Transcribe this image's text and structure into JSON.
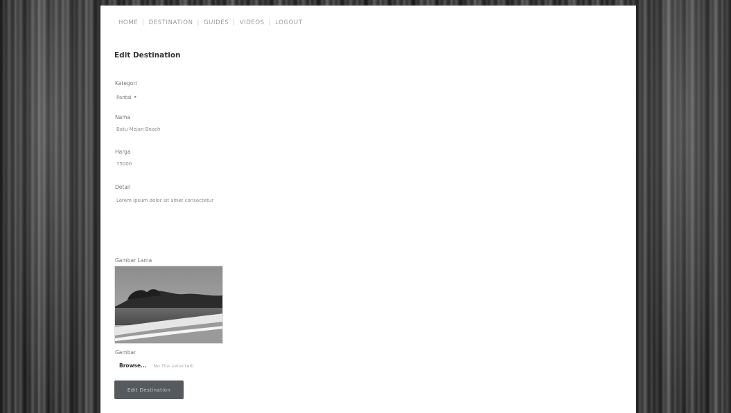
{
  "nav": {
    "items": [
      {
        "label": "HOME"
      },
      {
        "label": "DESTINATION"
      },
      {
        "label": "GUIDES"
      },
      {
        "label": "VIDEOS"
      },
      {
        "label": "LOGOUT"
      }
    ]
  },
  "page": {
    "title": "Edit Destination"
  },
  "form": {
    "category": {
      "label": "Kategori",
      "value": "Pantai"
    },
    "name": {
      "label": "Nama",
      "value": "Batu Mejan Beach"
    },
    "price": {
      "label": "Harga",
      "value": "75000"
    },
    "detail": {
      "label": "Detail",
      "value": "Lorem ipsum dolor sit amet consectetur"
    },
    "current_image": {
      "label": "Gambar Lama"
    },
    "new_image": {
      "label": "Gambar",
      "button_label": "Browse...",
      "status": "No file selected."
    },
    "submit_label": "Edit Destination"
  },
  "colors": {
    "submit_bg": "#555a5e",
    "page_bg": "#ffffff"
  }
}
